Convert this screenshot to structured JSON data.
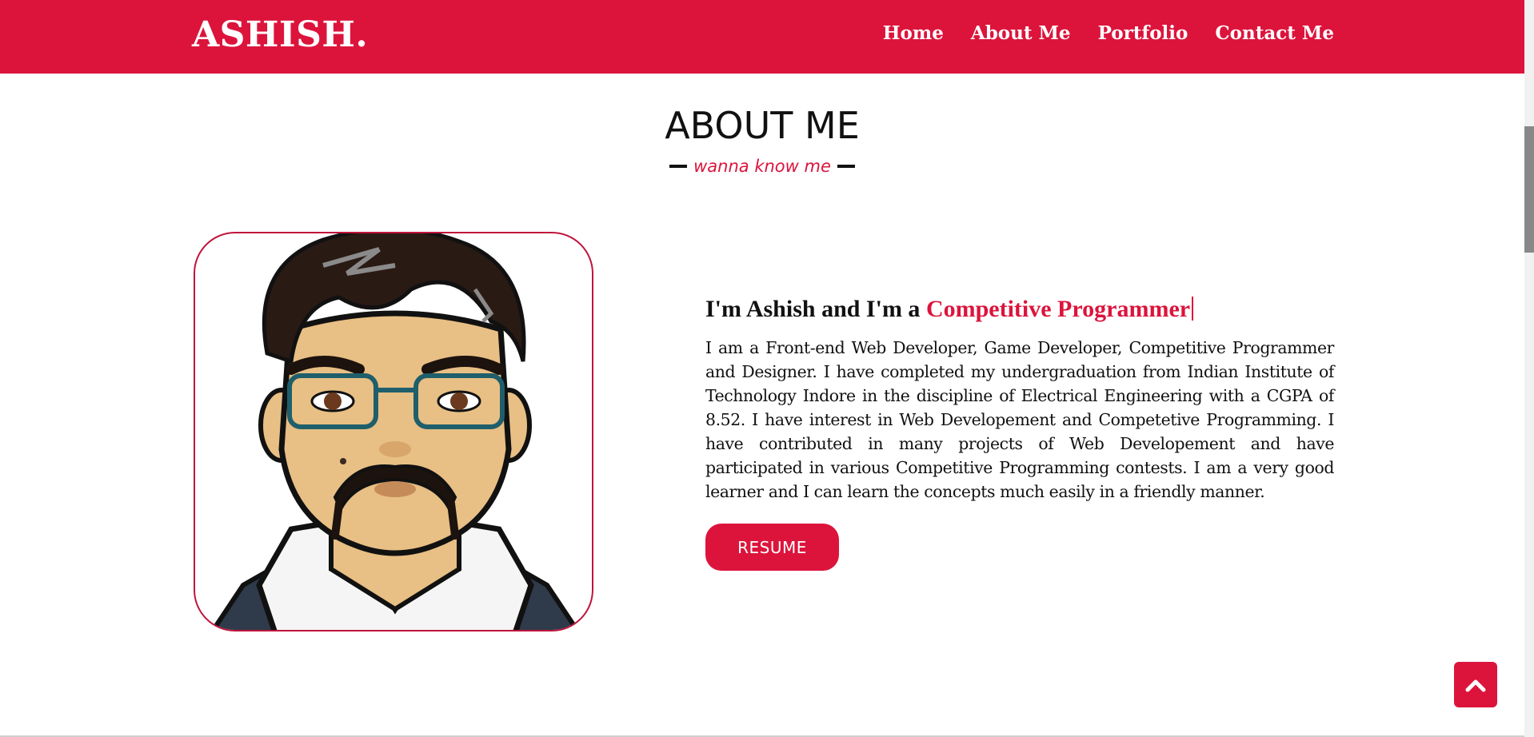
{
  "header": {
    "logo": "ASHISH.",
    "nav": [
      "Home",
      "About Me",
      "Portfolio",
      "Contact Me"
    ]
  },
  "about": {
    "title": "ABOUT ME",
    "subtitle": "wanna know me",
    "headline_prefix": "I'm Ashish and I'm a ",
    "headline_role": "Competitive Programmer",
    "bio": "I am a Front-end Web Developer, Game Developer, Competitive Programmer and Designer. I have completed my undergraduation from Indian Institute of Technology Indore in the discipline of Electrical Engineering with a CGPA of 8.52. I have interest in Web Developement and Competetive Programming. I have contributed in many projects of Web Developement and have participated in various Competitive Programming contests. I am a very good learner and I can learn the concepts much easily in a friendly manner.",
    "resume_label": "RESUME"
  },
  "colors": {
    "accent": "#dc143c",
    "text": "#111111",
    "background": "#ffffff"
  },
  "icons": {
    "scroll_top": "chevron-up-icon",
    "avatar": "cartoon-portrait"
  }
}
